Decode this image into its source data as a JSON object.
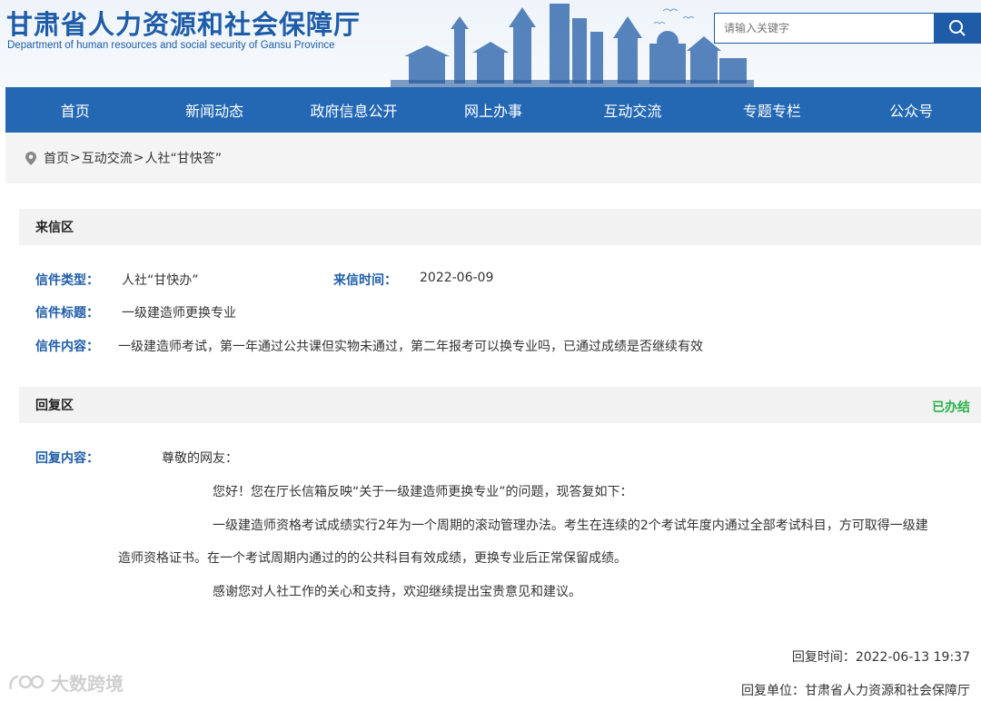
{
  "header": {
    "title_cn": "甘肃省人力资源和社会保障厅",
    "title_en": "Department of human resources and social security of Gansu Province",
    "search_placeholder": "请输入关键字"
  },
  "nav": {
    "items": [
      "首页",
      "新闻动态",
      "政府信息公开",
      "网上办事",
      "互动交流",
      "专题专栏",
      "公众号"
    ]
  },
  "breadcrumb": {
    "home": "首页",
    "sep1": ">",
    "section": "互动交流",
    "sep2": ">",
    "current": "人社“甘快答”"
  },
  "letter": {
    "section_title": "来信区",
    "type_label": "信件类型：",
    "type_value": "人社“甘快办”",
    "time_label": "来信时间：",
    "time_value": "2022-06-09",
    "subject_label": "信件标题：",
    "subject_value": "一级建造师更换专业",
    "content_label": "信件内容：",
    "content_value": "一级建造师考试，第一年通过公共课但实物未通过，第二年报考可以换专业吗，已通过成绩是否继续有效"
  },
  "reply": {
    "section_title": "回复区",
    "status": "已办结",
    "content_label": "回复内容：",
    "greeting": "尊敬的网友：",
    "p1": "您好！您在厅长信箱反映“关于一级建造师更换专业”的问题，现答复如下：",
    "p2a": "一级建造师资格考试成绩实行2年为一个周期的滚动管理办法。考生在连续的2个考试年度内通过全部考试科目，方可取得一级建",
    "p2b": "造师资格证书。在一个考试周期内通过的的公共科目有效成绩，更换专业后正常保留成绩。",
    "p3": "感谢您对人社工作的关心和支持，欢迎继续提出宝贵意见和建议。",
    "time": "回复时间：2022-06-13 19:37",
    "unit": "回复单位：甘肃省人力资源和社会保障厅"
  },
  "watermark": "大数跨境",
  "colors": {
    "brand_blue": "#1e5ca8",
    "nav_blue": "#2468b4",
    "status_green": "#2bb14a"
  }
}
